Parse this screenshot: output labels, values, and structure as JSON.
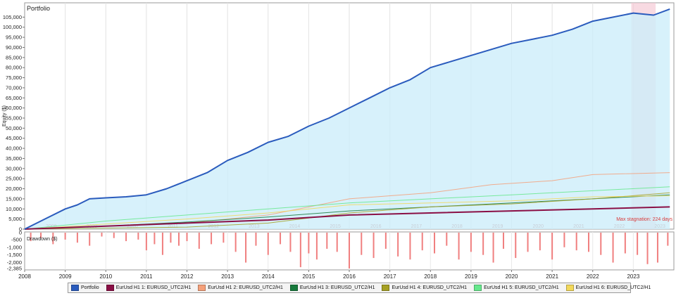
{
  "chart_data": [
    {
      "type": "line",
      "title": "Portfolio",
      "ylabel": "Equity ($)",
      "xlim": [
        2008,
        2024
      ],
      "ylim": [
        0,
        110000
      ],
      "yticks": [
        0,
        5000,
        10000,
        15000,
        20000,
        25000,
        30000,
        35000,
        40000,
        45000,
        50000,
        55000,
        60000,
        65000,
        70000,
        75000,
        80000,
        85000,
        90000,
        95000,
        100000,
        105000
      ],
      "ytick_labels": [
        "0",
        "5,000",
        "10,000",
        "15,000",
        "20,000",
        "25,000",
        "30,000",
        "35,000",
        "40,000",
        "45,000",
        "50,000",
        "55,000",
        "60,000",
        "65,000",
        "70,000",
        "75,000",
        "80,000",
        "85,000",
        "90,000",
        "95,000",
        "100,000",
        "105,000"
      ],
      "xticks": [
        "2008",
        "2009",
        "2010",
        "2011",
        "2012",
        "2013",
        "2014",
        "2015",
        "2016",
        "2017",
        "2018",
        "2019",
        "2020",
        "2021",
        "2022",
        "2023"
      ],
      "watermark_years": [
        "2008",
        "2009",
        "2010",
        "2011",
        "2012",
        "2013",
        "2014",
        "2015",
        "2016",
        "2017",
        "2018",
        "2019",
        "2020",
        "2021",
        "2022",
        "2023"
      ],
      "grid": true,
      "stagnation": {
        "start": 2022.95,
        "end": 2023.55,
        "label": "Max stagnation: 224 days"
      },
      "series": [
        {
          "name": "Portfolio",
          "color": "#2a5bbd",
          "width": 2,
          "x": [
            2008.0,
            2008.5,
            2009.0,
            2009.3,
            2009.6,
            2010.0,
            2010.5,
            2011.0,
            2011.5,
            2012.0,
            2012.5,
            2013.0,
            2013.5,
            2014.0,
            2014.5,
            2015.0,
            2015.5,
            2016.0,
            2016.5,
            2017.0,
            2017.5,
            2018.0,
            2018.5,
            2019.0,
            2019.5,
            2020.0,
            2020.5,
            2021.0,
            2021.5,
            2022.0,
            2022.5,
            2023.0,
            2023.5,
            2023.9
          ],
          "y": [
            0,
            5000,
            10000,
            12000,
            15000,
            15500,
            16000,
            17000,
            20000,
            24000,
            28000,
            34000,
            38000,
            43000,
            46000,
            51000,
            55000,
            60000,
            65000,
            70000,
            74000,
            80000,
            83000,
            86000,
            89000,
            92000,
            94000,
            96000,
            99000,
            103000,
            105000,
            107000,
            106000,
            109000
          ]
        },
        {
          "name": "EurUsd H1 1:  EURUSD_UTC2/H1",
          "color": "#8a0f45",
          "width": 2,
          "x": [
            2008,
            2010,
            2012,
            2014,
            2016,
            2018,
            2020,
            2022,
            2023.9
          ],
          "y": [
            0,
            1500,
            3000,
            4500,
            7000,
            8000,
            9000,
            10000,
            11000
          ]
        },
        {
          "name": "EurUsd H1 2:  EURUSD_UTC2/H1",
          "color": "#f5a07a",
          "width": 1,
          "x": [
            2008,
            2010,
            2012,
            2014,
            2016,
            2018,
            2019.5,
            2021,
            2022,
            2023.9
          ],
          "y": [
            0,
            1500,
            3000,
            7000,
            15000,
            18000,
            22000,
            24000,
            27000,
            28000
          ]
        },
        {
          "name": "EurUsd H1 3:  EURUSD_UTC2/H1",
          "color": "#177a3c",
          "width": 1,
          "x": [
            2008,
            2010,
            2012,
            2014,
            2016,
            2018,
            2020,
            2022,
            2023.9
          ],
          "y": [
            0,
            1500,
            3500,
            6000,
            9000,
            11000,
            13000,
            15000,
            17000
          ]
        },
        {
          "name": "EurUsd H1 4:  EURUSD_UTC2/H1",
          "color": "#a6a024",
          "width": 1,
          "x": [
            2008,
            2010,
            2012,
            2014,
            2016,
            2018,
            2020,
            2022,
            2023.9
          ],
          "y": [
            0,
            500,
            1000,
            3000,
            8000,
            11000,
            12500,
            15000,
            18000
          ]
        },
        {
          "name": "EurUsd H1 5:  EURUSD_UTC2/H1",
          "color": "#66e88c",
          "width": 1,
          "x": [
            2008,
            2010,
            2012,
            2014,
            2016,
            2018,
            2020,
            2022,
            2023.9
          ],
          "y": [
            0,
            4000,
            7000,
            10000,
            13000,
            15000,
            17000,
            19000,
            21000
          ]
        },
        {
          "name": "EurUsd H1 6:  EURUSD_UTC2/H1",
          "color": "#f2d85a",
          "width": 1,
          "x": [
            2008,
            2010,
            2012,
            2014,
            2016,
            2018,
            2020,
            2022,
            2023.9
          ],
          "y": [
            0,
            2500,
            5000,
            8000,
            12000,
            13000,
            14000,
            16000,
            16500
          ]
        }
      ]
    },
    {
      "type": "bar",
      "title": "Drawdown ($)",
      "ylim": [
        -2385,
        0
      ],
      "yticks": [
        0,
        -500,
        -1000,
        -1500,
        -2000,
        -2385
      ],
      "ytick_labels": [
        "0",
        "-500",
        "-1,000",
        "-1,500",
        "-2,000",
        "-2,385"
      ],
      "bar_color": "#f07f7f",
      "x": [
        2008.15,
        2008.4,
        2008.7,
        2009.0,
        2009.3,
        2009.6,
        2009.9,
        2010.2,
        2010.5,
        2010.8,
        2011.0,
        2011.2,
        2011.4,
        2011.6,
        2011.8,
        2012.0,
        2012.3,
        2012.6,
        2012.9,
        2013.2,
        2013.45,
        2013.7,
        2014.0,
        2014.3,
        2014.55,
        2014.8,
        2015.0,
        2015.2,
        2015.45,
        2015.7,
        2016.0,
        2016.3,
        2016.6,
        2016.9,
        2017.2,
        2017.5,
        2017.8,
        2018.1,
        2018.4,
        2018.7,
        2019.0,
        2019.3,
        2019.55,
        2019.8,
        2020.1,
        2020.4,
        2020.7,
        2021.0,
        2021.3,
        2021.6,
        2021.9,
        2022.2,
        2022.5,
        2022.8,
        2023.1,
        2023.35,
        2023.6,
        2023.85
      ],
      "values": [
        -600,
        -400,
        -800,
        -500,
        -700,
        -900,
        -300,
        -400,
        -600,
        -500,
        -1200,
        -800,
        -1500,
        -700,
        -900,
        -600,
        -1100,
        -800,
        -700,
        -1300,
        -2000,
        -900,
        -1500,
        -800,
        -1300,
        -2300,
        -1400,
        -1800,
        -1100,
        -1300,
        -2385,
        -1500,
        -1700,
        -1100,
        -1600,
        -1800,
        -1200,
        -1400,
        -900,
        -1800,
        -1300,
        -1500,
        -2000,
        -1100,
        -1700,
        -1300,
        -1200,
        -1800,
        -1000,
        -1200,
        -1300,
        -1500,
        -2000,
        -1400,
        -1500,
        -2100,
        -2000,
        -900
      ]
    }
  ],
  "legend": [
    {
      "label": "Portfolio",
      "color": "#2a5bbd"
    },
    {
      "label": "EurUsd H1 1:  EURUSD_UTC2/H1",
      "color": "#8a0f45"
    },
    {
      "label": "EurUsd H1 2:  EURUSD_UTC2/H1",
      "color": "#f5a07a"
    },
    {
      "label": "EurUsd H1 3:  EURUSD_UTC2/H1",
      "color": "#177a3c"
    },
    {
      "label": "EurUsd H1 4:  EURUSD_UTC2/H1",
      "color": "#a6a024"
    },
    {
      "label": "EurUsd H1 5:  EURUSD_UTC2/H1",
      "color": "#66e88c"
    },
    {
      "label": "EurUsd H1 6:  EURUSD_UTC2/H1",
      "color": "#f2d85a"
    }
  ]
}
